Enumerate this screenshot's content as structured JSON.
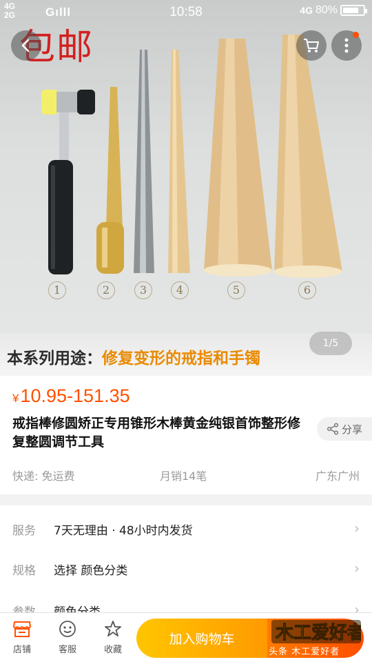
{
  "status_bar": {
    "network_top": "4G",
    "network_bottom": "2G",
    "carrier": "Gılll",
    "time": "10:58",
    "network_right": "4G",
    "battery_text": "80%",
    "battery_level": 0.8
  },
  "gallery": {
    "watermark": "包邮",
    "tool_numbers": [
      "1",
      "2",
      "3",
      "4",
      "5",
      "6"
    ],
    "caption_prefix": "本系列用途：",
    "caption_highlight": "修复变形的戒指和手镯",
    "page_indicator": "1/5"
  },
  "product": {
    "currency": "¥",
    "price_range": "10.95-151.35",
    "title": "戒指棒修圆矫正专用锥形木棒黄金纯银首饰整形修复整圆调节工具",
    "share_label": "分享",
    "shipping": "快递: 免运费",
    "monthly_sales": "月销14笔",
    "location": "广东广州"
  },
  "attributes": [
    {
      "key": "服务",
      "value": "7天无理由 · 48小时内发货"
    },
    {
      "key": "规格",
      "value": "选择 颜色分类"
    },
    {
      "key": "参数",
      "value": "颜色分类"
    }
  ],
  "bottom_bar": {
    "shop_label": "店铺",
    "service_label": "客服",
    "favorite_label": "收藏",
    "add_to_cart_label": "加入购物车",
    "promo_logo_text": "木工爱好者",
    "promo_caption": "头条  木工爱好者"
  },
  "colors": {
    "price": "#ff5000",
    "accent_orange": "#ff9a00",
    "watermark_red": "#d32020"
  },
  "icons": [
    "back-icon",
    "cart-icon",
    "more-icon",
    "share-icon",
    "chevron-right-icon",
    "shop-icon",
    "service-icon",
    "star-icon"
  ]
}
